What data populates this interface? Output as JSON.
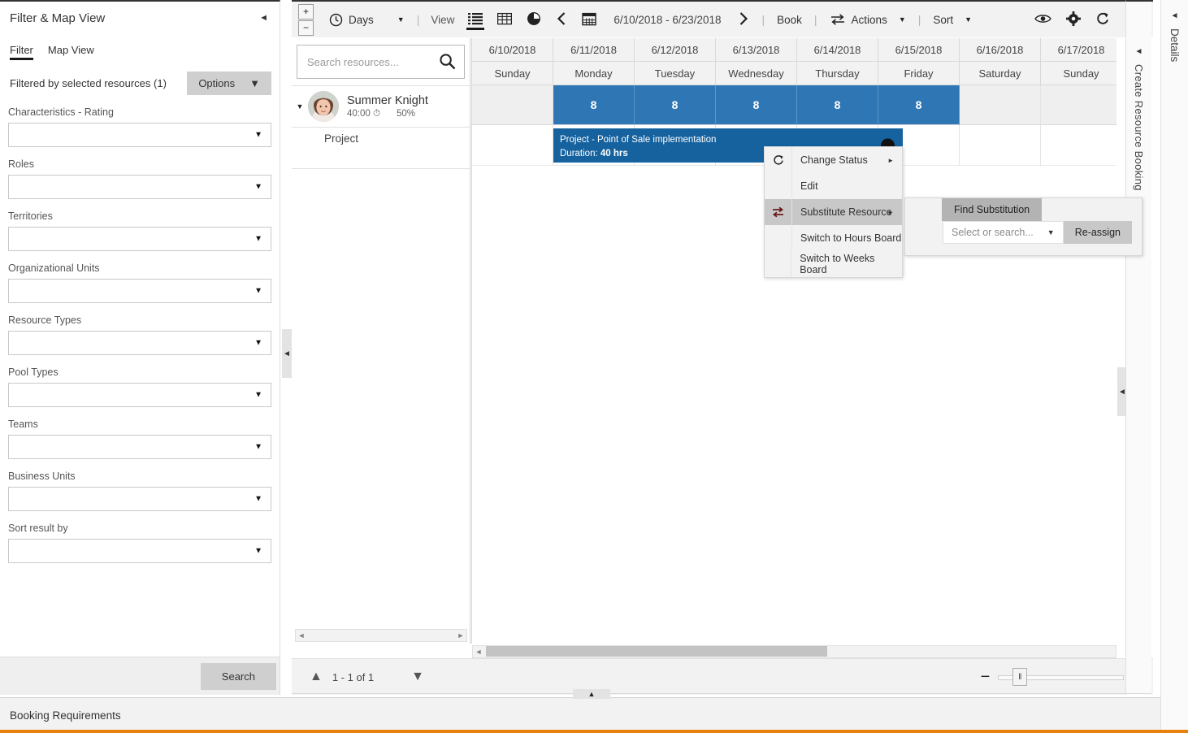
{
  "filter_panel": {
    "title": "Filter & Map View",
    "collapse_icon": "chevron-left-icon",
    "tabs": [
      {
        "label": "Filter",
        "active": true
      },
      {
        "label": "Map View",
        "active": false
      }
    ],
    "filtered_by_label": "Filtered by selected resources (1)",
    "options_button": "Options",
    "fields": [
      {
        "label": "Characteristics - Rating",
        "value": ""
      },
      {
        "label": "Roles",
        "value": ""
      },
      {
        "label": "Territories",
        "value": ""
      },
      {
        "label": "Organizational Units",
        "value": ""
      },
      {
        "label": "Resource Types",
        "value": ""
      },
      {
        "label": "Pool Types",
        "value": ""
      },
      {
        "label": "Teams",
        "value": ""
      },
      {
        "label": "Business Units",
        "value": ""
      },
      {
        "label": "Sort result by",
        "value": ""
      }
    ],
    "search_button": "Search"
  },
  "toolbar": {
    "zoom_in_icon": "plus-box-icon",
    "zoom_out_icon": "minus-box-icon",
    "scale_icon": "clock-icon",
    "scale_label": "Days",
    "view_label": "View",
    "view_list_icon": "list-view-icon",
    "view_grid_icon": "grid-view-icon",
    "view_map_icon": "globe-view-icon",
    "prev_icon": "chevron-left-icon",
    "calendar_icon": "calendar-icon",
    "date_range": "6/10/2018 - 6/23/2018",
    "next_icon": "chevron-right-icon",
    "book_label": "Book",
    "actions_icon": "swap-arrows-icon",
    "actions_label": "Actions",
    "sort_label": "Sort",
    "eye_icon": "eye-icon",
    "gear_icon": "gear-icon",
    "refresh_icon": "refresh-icon",
    "expand_icon": "fullscreen-icon"
  },
  "resources": {
    "search_placeholder": "Search resources...",
    "search_value": "",
    "search_icon": "search-icon",
    "rows": [
      {
        "expander_icon": "caret-down-icon",
        "avatar": "avatar",
        "name": "Summer Knight",
        "hours": "40:00",
        "hours_icon": "clock-icon",
        "utilization": "50%",
        "child": "Project"
      }
    ]
  },
  "schedule": {
    "dates": [
      "6/10/2018",
      "6/11/2018",
      "6/12/2018",
      "6/13/2018",
      "6/14/2018",
      "6/15/2018",
      "6/16/2018",
      "6/17/2018"
    ],
    "days": [
      "Sunday",
      "Monday",
      "Tuesday",
      "Wednesday",
      "Thursday",
      "Friday",
      "Saturday",
      "Sunday"
    ],
    "capacity_cells": [
      "",
      "8",
      "8",
      "8",
      "8",
      "8",
      "",
      ""
    ],
    "booking": {
      "title": "Project - Point of Sale implementation",
      "duration_label": "Duration:",
      "duration_value": "40 hrs",
      "status_icon": "status-dot-icon"
    }
  },
  "board_footer": {
    "up_icon": "chevron-up-icon",
    "pager_text": "1 - 1 of 1",
    "down_icon": "chevron-down-icon",
    "zoom_out": "−",
    "zoom_in": "+"
  },
  "context_menu": {
    "items": [
      {
        "label": "Change Status",
        "icon": "change-status-icon",
        "has_submenu": true,
        "selected": false
      },
      {
        "label": "Edit",
        "icon": "",
        "has_submenu": false,
        "selected": false
      },
      {
        "label": "Substitute Resource",
        "icon": "substitute-icon",
        "has_submenu": true,
        "selected": true
      },
      {
        "label": "Switch to Hours Board",
        "icon": "",
        "has_submenu": false,
        "selected": false
      },
      {
        "label": "Switch to Weeks Board",
        "icon": "",
        "has_submenu": false,
        "selected": false
      }
    ]
  },
  "substitution_panel": {
    "tab_label": "Find Substitution",
    "select_placeholder": "Select or search...",
    "select_value": "",
    "reassign_button": "Re-assign"
  },
  "create_resource_booking_rail": {
    "collapse_icon": "chevron-left-icon",
    "label": "Create Resource Booking"
  },
  "details_rail": {
    "collapse_icon": "chevron-left-icon",
    "label": "Details"
  },
  "bottom_panel": {
    "title": "Booking Requirements",
    "expand_icon": "chevron-up-icon"
  },
  "colors": {
    "accent_blue": "#2f76b5",
    "booking_blue": "#15629f",
    "orange_strip": "#e8820c",
    "toolbar_bg": "#f2f2f2"
  }
}
